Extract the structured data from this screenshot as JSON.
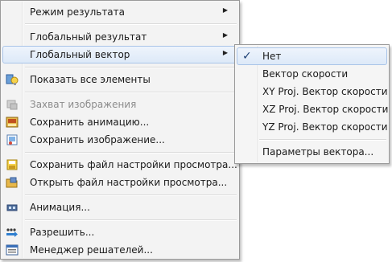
{
  "main_menu": {
    "items": [
      {
        "label": "Режим результата"
      },
      {
        "label": "Глобальный результат"
      },
      {
        "label": "Глобальный вектор"
      },
      {
        "label": "Показать все элементы"
      },
      {
        "label": "Захват изображения"
      },
      {
        "label": "Сохранить анимацию..."
      },
      {
        "label": "Сохранить изображение..."
      },
      {
        "label": "Сохранить файл настройки просмотра..."
      },
      {
        "label": "Открыть файл настройки просмотра..."
      },
      {
        "label": "Анимация..."
      },
      {
        "label": "Разрешить..."
      },
      {
        "label": "Менеджер решателей..."
      }
    ]
  },
  "sub_menu": {
    "check_mark": "✓",
    "items": [
      {
        "label": "Нет"
      },
      {
        "label": "Вектор скорости"
      },
      {
        "label": "XY Proj. Вектор скорости"
      },
      {
        "label": "XZ Proj. Вектор скорости"
      },
      {
        "label": "YZ Proj. Вектор скорости"
      },
      {
        "label": "Параметры вектора..."
      }
    ]
  },
  "arrow_glyph": "▶"
}
